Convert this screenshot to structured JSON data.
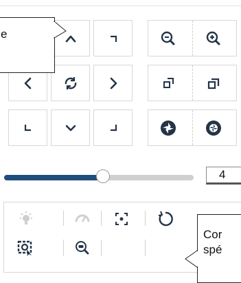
{
  "ptz": {
    "buttons": [
      {
        "name": "tilt-up-button",
        "icon": "chevron-up-icon"
      },
      {
        "name": "pan-up-right-button",
        "icon": "corner-up-right-icon"
      },
      {
        "name": "pan-left-button",
        "icon": "chevron-left-icon"
      },
      {
        "name": "auto-pan-button",
        "icon": "refresh-icon"
      },
      {
        "name": "pan-right-button",
        "icon": "chevron-right-icon"
      },
      {
        "name": "pan-down-left-button",
        "icon": "corner-down-left-icon"
      },
      {
        "name": "tilt-down-button",
        "icon": "chevron-down-icon"
      },
      {
        "name": "pan-down-right-button",
        "icon": "corner-down-right-icon"
      },
      {
        "name": "zoom-out-button",
        "icon": "zoom-out-icon"
      },
      {
        "name": "zoom-in-button",
        "icon": "zoom-in-icon"
      },
      {
        "name": "focus-near-button",
        "icon": "focus-near-icon"
      },
      {
        "name": "focus-far-button",
        "icon": "focus-far-icon"
      },
      {
        "name": "iris-open-button",
        "icon": "aperture-open-icon"
      },
      {
        "name": "iris-close-button",
        "icon": "aperture-close-icon"
      }
    ]
  },
  "speed": {
    "value": "4",
    "level_fraction": 0.52
  },
  "tooltips": {
    "left_partial": "e",
    "right_line1": "Cor",
    "right_line2": "spé"
  },
  "colors": {
    "accent": "#1f4e7d",
    "icon_dark": "#243447",
    "icon_light": "#cfcfcf"
  }
}
